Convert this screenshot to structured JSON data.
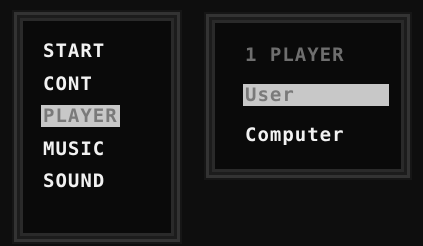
{
  "main_menu": {
    "items": [
      {
        "label": "START"
      },
      {
        "label": "CONT"
      },
      {
        "label": "PLAYER",
        "selected": true
      },
      {
        "label": "MUSIC"
      },
      {
        "label": "SOUND"
      }
    ]
  },
  "player_menu": {
    "header": "1 PLAYER",
    "options": [
      {
        "label": "User",
        "selected": true
      },
      {
        "label": "Computer"
      }
    ]
  },
  "colors": {
    "text": "#f2f2f2",
    "highlight_bg": "#c8c8c8",
    "highlight_text": "#7a7a7a",
    "header_text": "#6e6e6e",
    "panel_border": "#333333"
  }
}
